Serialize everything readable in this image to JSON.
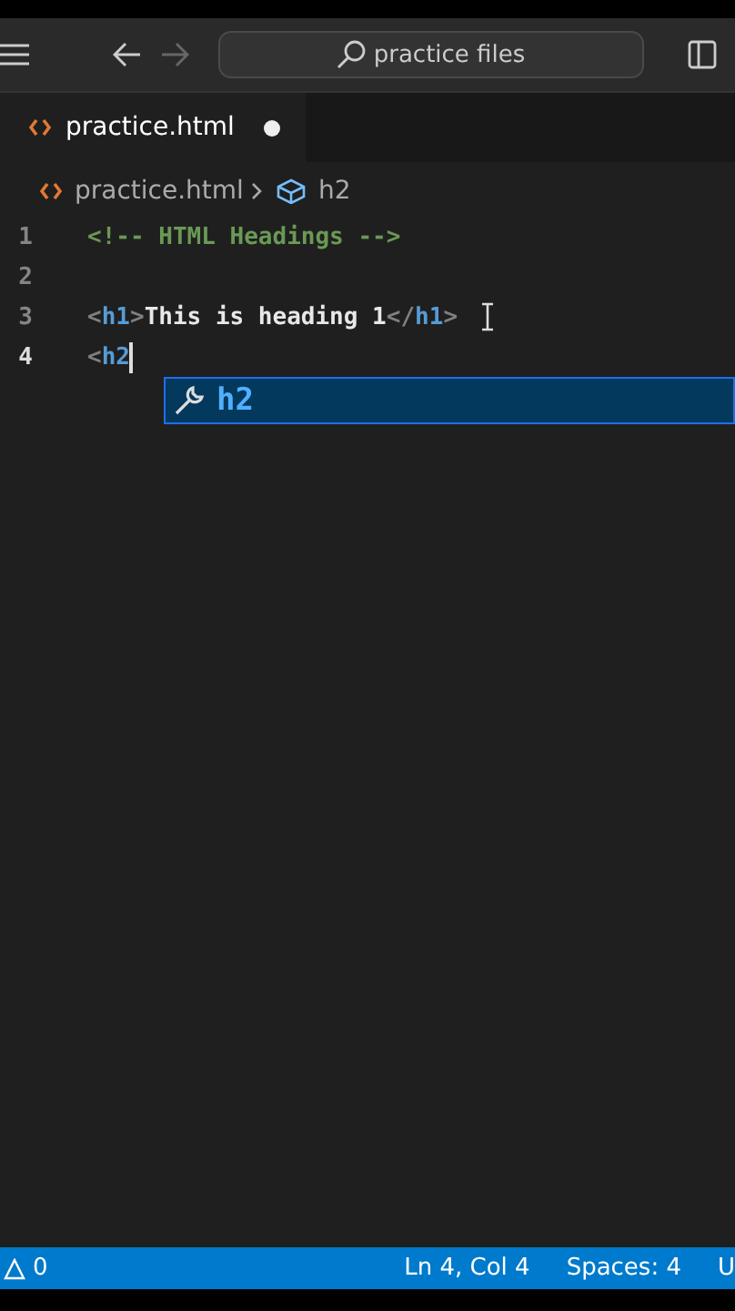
{
  "title_bar": {
    "search": {
      "value": "practice files"
    }
  },
  "tabs": [
    {
      "label": "practice.html",
      "selected": true,
      "modified": true
    }
  ],
  "breadcrumbs": [
    {
      "kind": "file",
      "label": "practice.html"
    },
    {
      "kind": "symbol",
      "label": "h2"
    }
  ],
  "editor": {
    "lines": [
      {
        "number": "1",
        "tokens": [
          {
            "kind": "comment",
            "text": "<!-- HTML Headings -->"
          }
        ]
      },
      {
        "number": "2"
      },
      {
        "number": "3",
        "tokens": [
          {
            "kind": "punct",
            "text": "<"
          },
          {
            "kind": "tag",
            "text": "h1"
          },
          {
            "kind": "punct",
            "text": ">"
          },
          {
            "kind": "text",
            "text": "This is heading 1"
          },
          {
            "kind": "punct",
            "text": "</"
          },
          {
            "kind": "tag",
            "text": "h1"
          },
          {
            "kind": "punct",
            "text": ">"
          }
        ]
      },
      {
        "number": "4",
        "tokens": [
          {
            "kind": "punct",
            "text": "<"
          },
          {
            "kind": "tag",
            "text": "h2"
          }
        ],
        "cursor": true
      }
    ],
    "suggestions": [
      {
        "label": "h2",
        "selected": true
      }
    ]
  },
  "status_bar": {
    "warnings": "0",
    "items": [
      "Ln 4, Col 4",
      "Spaces: 4",
      "U"
    ]
  }
}
